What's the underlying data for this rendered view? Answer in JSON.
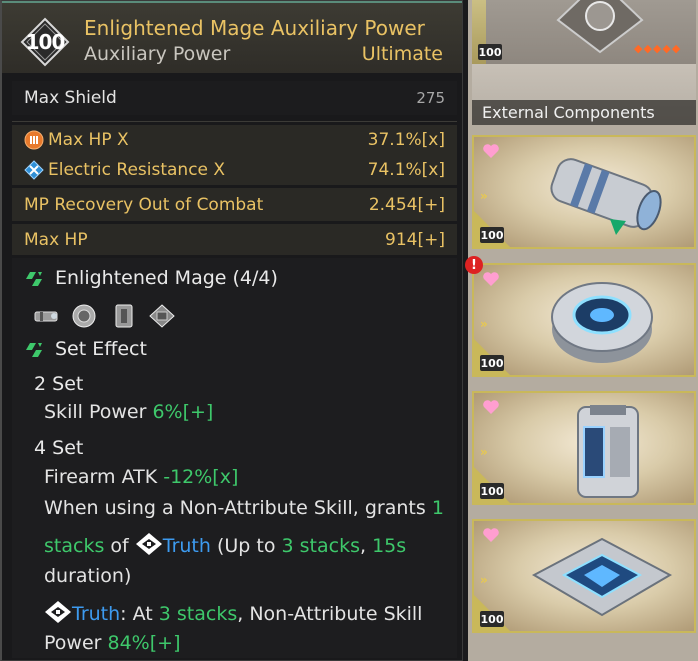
{
  "tooltip": {
    "level": "100",
    "title": "Enlightened Mage Auxiliary Power",
    "subtitle": "Auxiliary Power",
    "rarity": "Ultimate",
    "base_stat": {
      "label": "Max Shield",
      "value": "275"
    },
    "sub_stats": [
      {
        "label": "Max HP X",
        "value": "37.1%[x]",
        "icon": "hp-icon"
      },
      {
        "label": "Electric Resistance X",
        "value": "74.1%[x]",
        "icon": "electric-icon"
      },
      {
        "label": "MP Recovery Out of Combat",
        "value": "2.454[+]"
      },
      {
        "label": "Max HP",
        "value": "914[+]"
      }
    ],
    "set": {
      "name": "Enlightened Mage (4/4)",
      "effect_heading": "Set Effect",
      "two_set_label": "2 Set",
      "two_set_stat": "Skill Power ",
      "two_set_value": "6%[+]",
      "four_set_label": "4 Set",
      "four_set_stat": "Firearm ATK ",
      "four_set_value": "-12%[x]",
      "desc1": "When using a Non-Attribute Skill, grants ",
      "desc1_num": "1",
      "desc2_a": "stacks",
      "desc2_b": " of ",
      "desc2_truth": "Truth",
      "desc2_c": " (Up to ",
      "desc2_d": "3 stacks",
      "desc2_e": ", ",
      "desc2_f": "15s",
      "desc3": "duration)",
      "desc4_truth": "Truth",
      "desc4_a": ": At ",
      "desc4_b": "3 stacks",
      "desc4_c": ", Non-Attribute Skill",
      "desc5_a": "Power ",
      "desc5_b": "84%[+]"
    }
  },
  "inventory": {
    "section_label": "External Components",
    "cards": [
      {
        "level": "100"
      },
      {
        "level": "100"
      },
      {
        "level": "100"
      },
      {
        "level": "100"
      },
      {
        "level": "100"
      }
    ],
    "first_card_dots": "◆◆◆◆◆",
    "alert": "!"
  },
  "colors": {
    "gold": "#e9c264",
    "green": "#3ec86b",
    "blue": "#3d9bf0",
    "card_border": "#c9b85a"
  }
}
